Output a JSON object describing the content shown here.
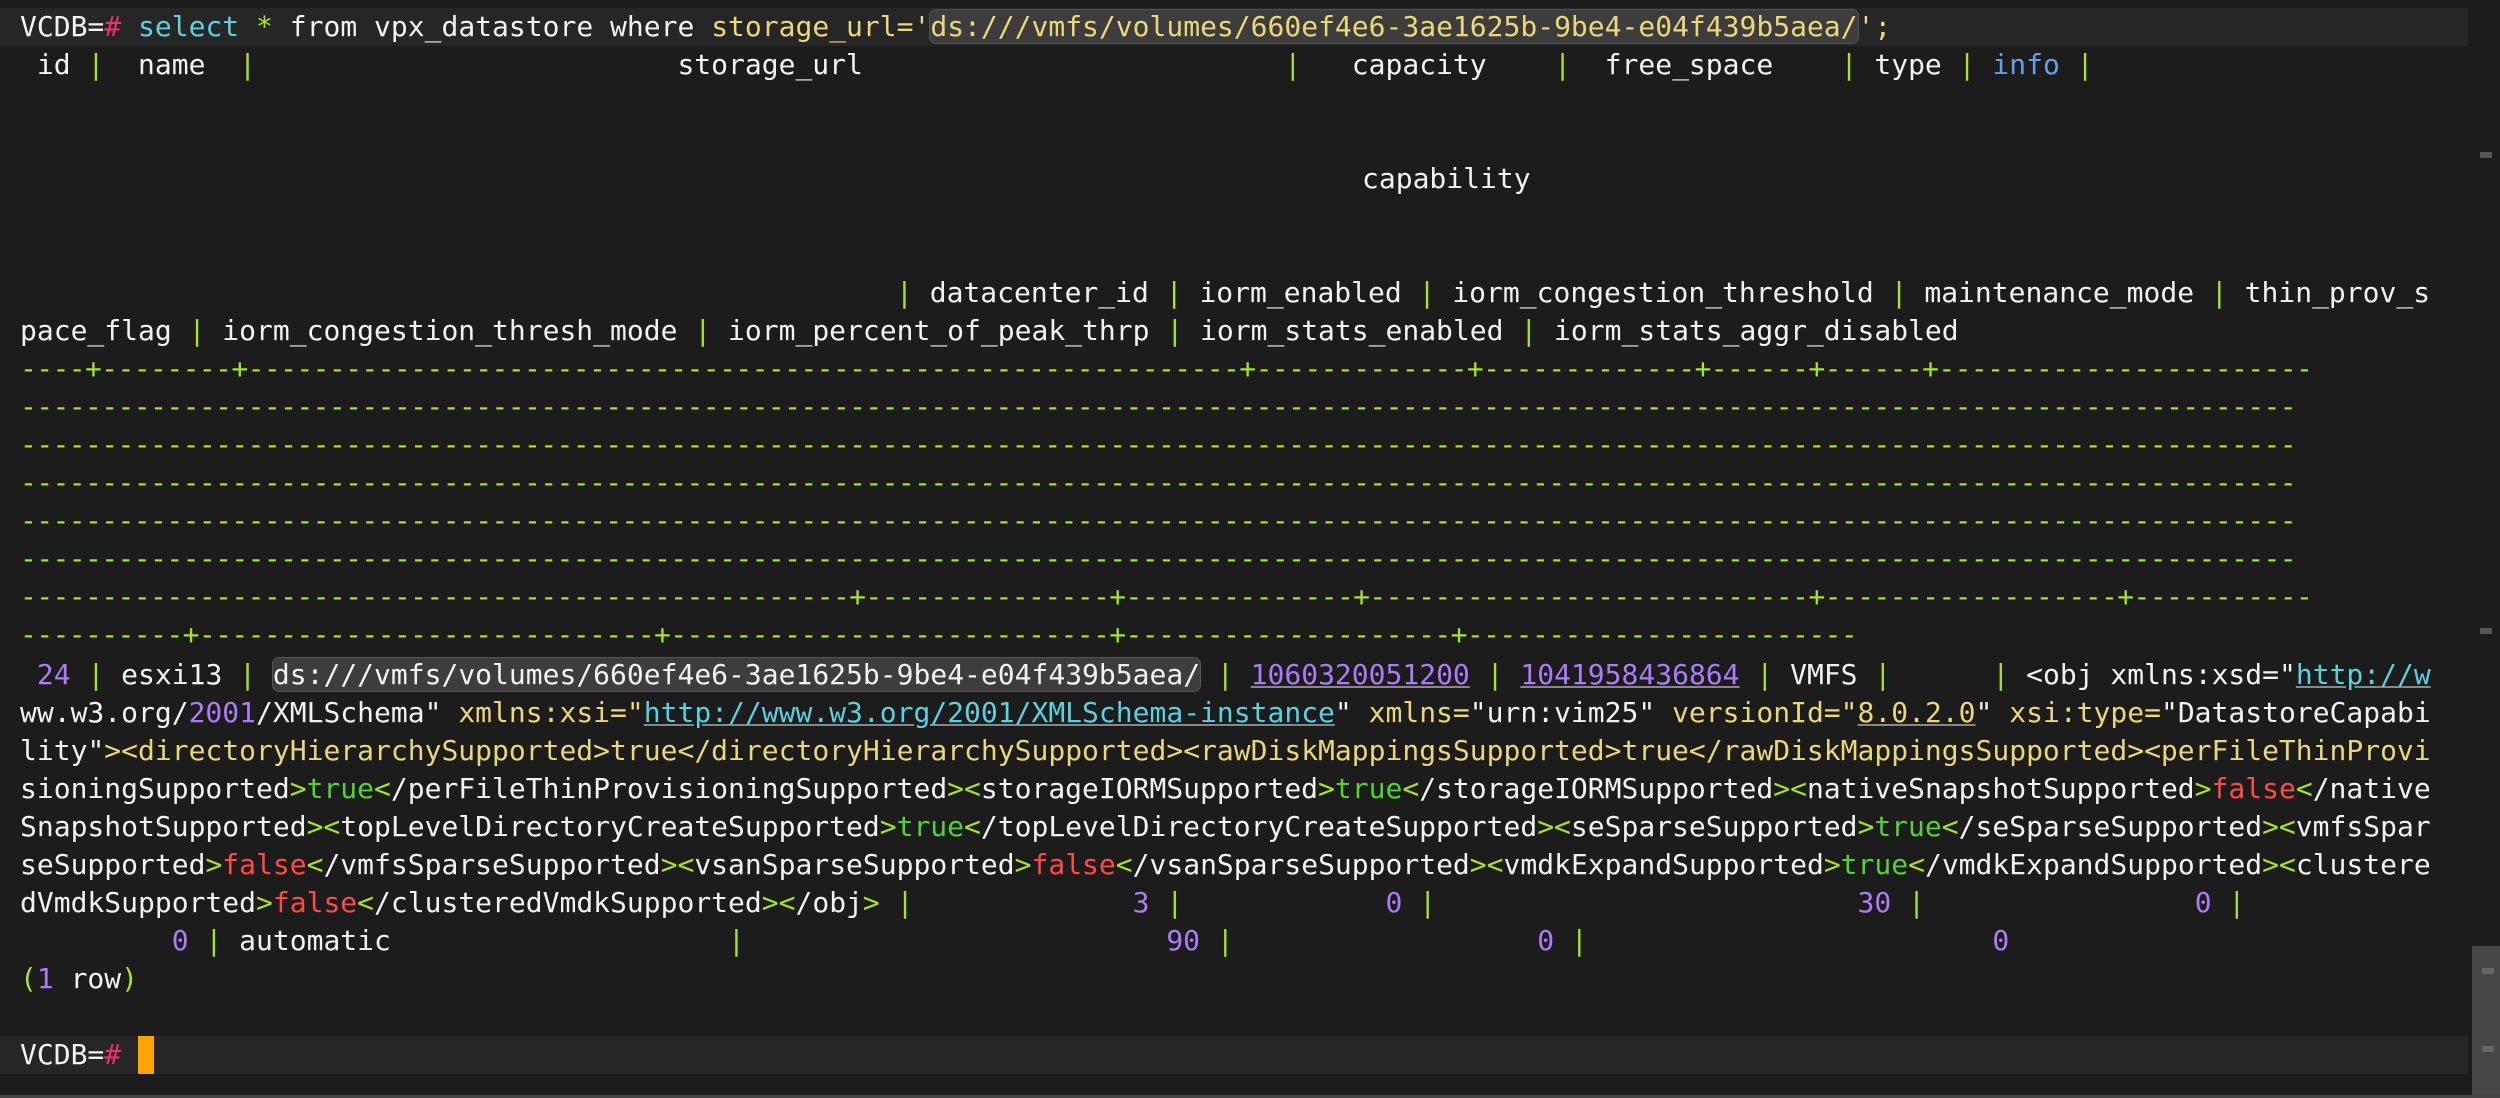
{
  "terminal": {
    "prompt": "VCDB=",
    "prompt_hash": "#",
    "command": {
      "kw_select": "select",
      "star": "*",
      "from_part": "from vpx_datastore where",
      "field": "storage_url=",
      "quote_open": "'",
      "value": "ds:///vmfs/volumes/660ef4e6-3ae1625b-9be4-e04f439b5aea/",
      "quote_close": "'",
      "semicolon": ";"
    },
    "header": {
      "line1": {
        "id": " id ",
        "name": "  name  ",
        "storage_url": "                         storage_url                         ",
        "capacity": "   capacity    ",
        "free_space": "  free_space    ",
        "type": " type ",
        "info": " info "
      },
      "capability": "capability",
      "line3": {
        "lead": "                                                                                                    ",
        "datacenter_id": " datacenter_id ",
        "iorm_enabled": " iorm_enabled ",
        "iorm_congestion_threshold": " iorm_congestion_threshold ",
        "maintenance_mode": " maintenance_mode ",
        "thin_prov_s": " thin_prov_s"
      },
      "line4": {
        "pace_flag": "pace_flag ",
        "iorm_congestion_thresh_mode": " iorm_congestion_thresh_mode ",
        "iorm_percent_of_peak_thrp": " iorm_percent_of_peak_thrp ",
        "iorm_stats_enabled": " iorm_stats_enabled ",
        "iorm_stats_aggr_disabled": " iorm_stats_aggr_disabled"
      }
    },
    "separators": [
      "----+--------+-------------------------------------------------------------+-------------+-------------+------+------+-----------------------",
      "--------------------------------------------------------------------------------------------------------------------------------------------",
      "--------------------------------------------------------------------------------------------------------------------------------------------",
      "--------------------------------------------------------------------------------------------------------------------------------------------",
      "--------------------------------------------------------------------------------------------------------------------------------------------",
      "--------------------------------------------------------------------------------------------------------------------------------------------",
      "---------------------------------------------------+---------------+--------------+---------------------------+------------------+-----------",
      "----------+----------------------------+---------------------------+--------------------+------------------------"
    ],
    "row": {
      "id": "24",
      "name": "esxi13",
      "storage_url": "ds:///vmfs/volumes/660ef4e6-3ae1625b-9be4-e04f439b5aea/",
      "capacity": "1060320051200",
      "free_space": "1041958436864",
      "type": "VMFS",
      "info": "",
      "capability_xml": {
        "obj_open": "<obj xmlns:xsd=\"",
        "xsd_url_a": "http://w",
        "xsd_url_b": "ww.w3.org/",
        "xsd_year": "2001",
        "xsd_url_c": "/XMLSchema",
        "xsi_attr": "xmlns:xsi=",
        "xsi_url": "http://www.w3.org/2001/XMLSchema-instance",
        "xmlns_attr": "xmlns=",
        "xmlns_val": "urn:vim25",
        "version_attr": "versionId=",
        "version_val": "8.0.2.0",
        "type_attr": "xsi:type=",
        "type_val_a": "DatastoreCapabi",
        "type_val_b": "lity",
        "directoryHierarchySupported": "true",
        "rawDiskMappingsSupported": "true",
        "perFileThinProvisioningSupported": "true",
        "storageIORMSupported": "true",
        "nativeSnapshotSupported": "false",
        "topLevelDirectoryCreateSupported": "true",
        "seSparseSupported": "true",
        "vmfsSparseSupported": "false",
        "vsanSparseSupported": "false",
        "vmdkExpandSupported": "true",
        "clusteredVmdkSupported": "false"
      },
      "datacenter_id": "3",
      "iorm_enabled": "0",
      "iorm_congestion_threshold": "30",
      "maintenance_mode": "0",
      "thin_prov_space_flag": "0",
      "iorm_congestion_thresh_mode": "automatic",
      "iorm_percent_of_peak_thrp": "90",
      "iorm_stats_enabled": "0",
      "iorm_stats_aggr_disabled": "0"
    },
    "row_count": {
      "open": "(",
      "num": "1",
      "word": " row",
      "close": ")"
    }
  },
  "colors": {
    "background": "#1c1c1c",
    "separator": "#a6e22e",
    "keyword": "#5ecfe0",
    "string": "#e9d77b",
    "number": "#ab7cf7",
    "false": "#ff4a4a",
    "true": "#54d133",
    "cursor": "#ffa500",
    "prompt_hash": "#f0306e"
  }
}
